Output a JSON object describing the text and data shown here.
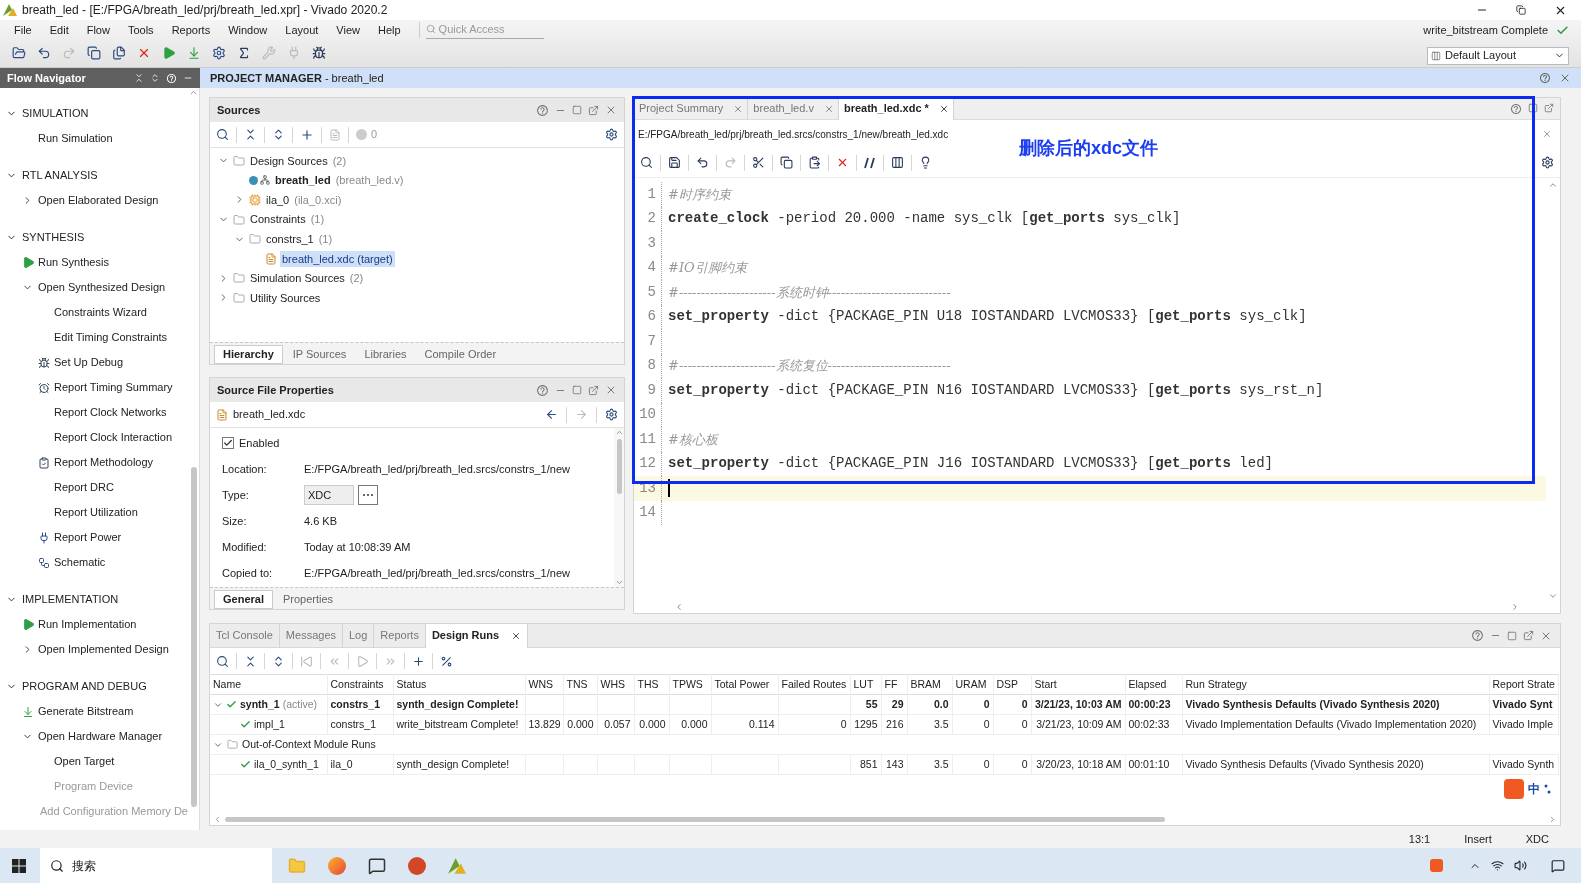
{
  "window": {
    "title": "breath_led - [E:/FPGA/breath_led/prj/breath_led.xpr] - Vivado 2020.2"
  },
  "menu": [
    "File",
    "Edit",
    "Flow",
    "Tools",
    "Reports",
    "Window",
    "Layout",
    "View",
    "Help"
  ],
  "quick_access": {
    "placeholder": "Quick Access"
  },
  "run_status": {
    "text": "write_bitstream Complete",
    "complete": true
  },
  "layout_select": {
    "value": "Default Layout"
  },
  "flow_navigator": {
    "title": "Flow Navigator",
    "sections": [
      {
        "title": "SIMULATION",
        "expanded": true,
        "items": [
          {
            "label": "Run Simulation",
            "kind": "plain",
            "disabled": false
          }
        ]
      },
      {
        "title": "RTL ANALYSIS",
        "expanded": true,
        "items": [
          {
            "label": "Open Elaborated Design",
            "kind": "group",
            "disabled": false,
            "expanded": false
          }
        ]
      },
      {
        "title": "SYNTHESIS",
        "expanded": true,
        "items": [
          {
            "label": "Run Synthesis",
            "kind": "run",
            "disabled": false
          },
          {
            "label": "Open Synthesized Design",
            "kind": "group",
            "disabled": false,
            "expanded": true,
            "children": [
              {
                "label": "Constraints Wizard",
                "kind": "plain",
                "disabled": false
              },
              {
                "label": "Edit Timing Constraints",
                "kind": "plain",
                "disabled": false
              },
              {
                "label": "Set Up Debug",
                "kind": "debug",
                "disabled": false
              },
              {
                "label": "Report Timing Summary",
                "kind": "timing",
                "disabled": false
              },
              {
                "label": "Report Clock Networks",
                "kind": "plain",
                "disabled": false
              },
              {
                "label": "Report Clock Interaction",
                "kind": "plain",
                "disabled": false
              },
              {
                "label": "Report Methodology",
                "kind": "methodology",
                "disabled": false
              },
              {
                "label": "Report DRC",
                "kind": "plain",
                "disabled": false
              },
              {
                "label": "Report Utilization",
                "kind": "plain",
                "disabled": false
              },
              {
                "label": "Report Power",
                "kind": "power",
                "disabled": false
              },
              {
                "label": "Schematic",
                "kind": "schematic",
                "disabled": false
              }
            ]
          }
        ]
      },
      {
        "title": "IMPLEMENTATION",
        "expanded": true,
        "items": [
          {
            "label": "Run Implementation",
            "kind": "run",
            "disabled": false
          },
          {
            "label": "Open Implemented Design",
            "kind": "group",
            "disabled": false,
            "expanded": false
          }
        ]
      },
      {
        "title": "PROGRAM AND DEBUG",
        "expanded": true,
        "items": [
          {
            "label": "Generate Bitstream",
            "kind": "bitstream",
            "disabled": false
          },
          {
            "label": "Open Hardware Manager",
            "kind": "group",
            "disabled": false,
            "expanded": true,
            "children": [
              {
                "label": "Open Target",
                "kind": "plain",
                "disabled": false
              },
              {
                "label": "Program Device",
                "kind": "plain",
                "disabled": true
              },
              {
                "label": "Add Configuration Memory De",
                "kind": "plain",
                "disabled": true
              }
            ]
          }
        ]
      }
    ]
  },
  "project_manager": {
    "title": "**PROJECT MANAGER** - breath_led"
  },
  "sources": {
    "title": "Sources",
    "error_count": "0",
    "tree": [
      {
        "label": "Design Sources",
        "detail": "(2)",
        "kind": "folder",
        "expanded": true,
        "selected": false,
        "children": [
          {
            "label": "breath_led",
            "detail": "(breath_led.v)",
            "kind": "top",
            "selected": false
          },
          {
            "label": "ila_0",
            "detail": "(ila_0.xci)",
            "kind": "ip",
            "expanded": false,
            "selected": false
          }
        ]
      },
      {
        "label": "Constraints",
        "detail": "(1)",
        "kind": "folder",
        "expanded": true,
        "selected": false,
        "children": [
          {
            "label": "constrs_1",
            "detail": "(1)",
            "kind": "folder",
            "expanded": true,
            "selected": false,
            "children": [
              {
                "label": "breath_led.xdc (target)",
                "kind": "xdc",
                "selected": true
              }
            ]
          }
        ]
      },
      {
        "label": "Simulation Sources",
        "detail": "(2)",
        "kind": "folder",
        "expanded": false,
        "selected": false
      },
      {
        "label": "Utility Sources",
        "kind": "folder",
        "expanded": false,
        "selected": false
      }
    ],
    "tabs": [
      {
        "label": "Hierarchy",
        "selected": true
      },
      {
        "label": "IP Sources",
        "selected": false
      },
      {
        "label": "Libraries",
        "selected": false
      },
      {
        "label": "Compile Order",
        "selected": false
      }
    ]
  },
  "properties": {
    "title": "Source File Properties",
    "file": "breath_led.xdc",
    "enabled": {
      "label": "Enabled",
      "checked": true
    },
    "fields": [
      {
        "label": "Location:",
        "value": "E:/FPGA/breath_led/prj/breath_led.srcs/constrs_1/new",
        "kind": "text"
      },
      {
        "label": "Type:",
        "value": "XDC",
        "kind": "select"
      },
      {
        "label": "Size:",
        "value": "4.6 KB",
        "kind": "text"
      },
      {
        "label": "Modified:",
        "value": "Today at 10:08:39 AM",
        "kind": "text"
      },
      {
        "label": "Copied to:",
        "value": "E:/FPGA/breath_led/prj/breath_led.srcs/constrs_1/new",
        "kind": "text"
      }
    ],
    "tabs": [
      {
        "label": "General",
        "selected": true
      },
      {
        "label": "Properties",
        "selected": false
      }
    ]
  },
  "editor": {
    "tabs": [
      {
        "label": "Project Summary",
        "selected": false
      },
      {
        "label": "breath_led.v",
        "selected": false
      },
      {
        "label": "breath_led.xdc *",
        "selected": true
      }
    ],
    "path": "E:/FPGA/breath_led/prj/breath_led.srcs/constrs_1/new/breath_led.xdc",
    "annotation": "删除后的xdc文件",
    "lines": [
      {
        "number": "1",
        "text": "#时序约束",
        "kind": "comment",
        "current": false
      },
      {
        "number": "2",
        "text": "**create_clock** -period 20.000 -name sys_clk [**get_ports** sys_clk]",
        "kind": "code",
        "current": false
      },
      {
        "number": "3",
        "kind": "blank",
        "current": false
      },
      {
        "number": "4",
        "text": "#IO引脚约束",
        "kind": "comment",
        "current": false
      },
      {
        "number": "5",
        "text": "#----------------------系统时钟----------------------------",
        "kind": "comment",
        "current": false
      },
      {
        "number": "6",
        "text": "**set_property** -dict {PACKAGE_PIN U18 IOSTANDARD LVCMOS33} [**get_ports** sys_clk]",
        "kind": "code",
        "current": false
      },
      {
        "number": "7",
        "kind": "blank",
        "current": false
      },
      {
        "number": "8",
        "text": "#----------------------系统复位----------------------------",
        "kind": "comment",
        "current": false
      },
      {
        "number": "9",
        "text": "**set_property** -dict {PACKAGE_PIN N16 IOSTANDARD LVCMOS33} [**get_ports** sys_rst_n]",
        "kind": "code",
        "current": false
      },
      {
        "number": "10",
        "kind": "blank",
        "current": false
      },
      {
        "number": "11",
        "text": "#核心板",
        "kind": "comment",
        "current": false
      },
      {
        "number": "12",
        "text": "**set_property** -dict {PACKAGE_PIN J16 IOSTANDARD LVCMOS33} [**get_ports** led]",
        "kind": "code",
        "current": false
      },
      {
        "number": "13",
        "kind": "blank",
        "current": true
      },
      {
        "number": "14",
        "kind": "blank",
        "current": false
      }
    ]
  },
  "runs": {
    "tabs": [
      {
        "label": "Tcl Console",
        "selected": false
      },
      {
        "label": "Messages",
        "selected": false
      },
      {
        "label": "Log",
        "selected": false
      },
      {
        "label": "Reports",
        "selected": false
      },
      {
        "label": "Design Runs",
        "selected": true
      }
    ],
    "columns": [
      "Name",
      "Constraints",
      "Status",
      "WNS",
      "TNS",
      "WHS",
      "THS",
      "TPWS",
      "Total Power",
      "Failed Routes",
      "LUT",
      "FF",
      "BRAM",
      "URAM",
      "DSP",
      "Start",
      "Elapsed",
      "Run Strategy",
      "Report Strate"
    ],
    "rows": [
      {
        "kind": "run",
        "name": "synth_1",
        "tag": "(active)",
        "bold": true,
        "complete": true,
        "expanded": true,
        "cells": [
          "constrs_1",
          "synth_design Complete!",
          null,
          null,
          null,
          null,
          null,
          null,
          null,
          "55",
          "29",
          "0.0",
          "0",
          "0",
          "3/21/23, 10:03 AM",
          "00:00:23",
          "Vivado Synthesis Defaults (Vivado Synthesis 2020)",
          "Vivado Synt"
        ],
        "children": [
          {
            "kind": "run",
            "name": "impl_1",
            "bold": false,
            "complete": true,
            "cells": [
              "constrs_1",
              "write_bitstream Complete!",
              "13.829",
              "0.000",
              "0.057",
              "0.000",
              "0.000",
              "0.114",
              "0",
              "1295",
              "216",
              "3.5",
              "0",
              "0",
              "3/21/23, 10:09 AM",
              "00:02:33",
              "Vivado Implementation Defaults (Vivado Implementation 2020)",
              "Vivado Imple"
            ]
          }
        ]
      },
      {
        "kind": "group",
        "name": "Out-of-Context Module Runs",
        "expanded": true,
        "children": [
          {
            "kind": "run",
            "name": "ila_0_synth_1",
            "bold": false,
            "complete": true,
            "cells": [
              "ila_0",
              "synth_design Complete!",
              null,
              null,
              null,
              null,
              null,
              null,
              null,
              "851",
              "143",
              "3.5",
              "0",
              "0",
              "3/20/23, 10:18 AM",
              "00:01:10",
              "Vivado Synthesis Defaults (Vivado Synthesis 2020)",
              "Vivado Synth"
            ]
          }
        ]
      }
    ]
  },
  "ime": {
    "label": "中"
  },
  "status_bar": [
    "13:1",
    "Insert",
    "XDC"
  ],
  "taskbar": {
    "search": {
      "placeholder": "搜索"
    }
  }
}
